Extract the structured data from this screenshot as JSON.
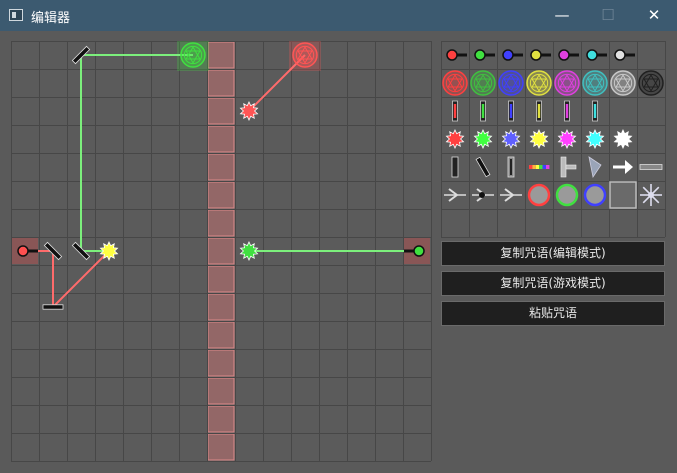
{
  "window": {
    "title": "编辑器",
    "minimize_glyph": "—",
    "maximize_glyph": "☐",
    "close_glyph": "✕"
  },
  "buttons": {
    "copy_edit": "复制咒语(编辑模式)",
    "copy_game": "复制咒语(游戏模式)",
    "paste": "粘贴咒语"
  },
  "board": {
    "cols": 15,
    "rows": 15,
    "wall_column": 7,
    "pieces": [
      {
        "type": "emitter",
        "color": "#ff5050",
        "col": 0,
        "row": 7
      },
      {
        "type": "emitter",
        "color": "#40e040",
        "col": 14,
        "row": 7,
        "dir": "left"
      },
      {
        "type": "mirror",
        "col": 2,
        "row": 0,
        "angle": -45
      },
      {
        "type": "mirror",
        "col": 1,
        "row": 7,
        "angle": 45
      },
      {
        "type": "mirror",
        "col": 2,
        "row": 7,
        "angle": 45
      },
      {
        "type": "mirror",
        "col": 1,
        "row": 9,
        "angle": 0
      },
      {
        "type": "star",
        "color": "#ffff40",
        "col": 3,
        "row": 7
      },
      {
        "type": "star",
        "color": "#ff5555",
        "col": 8,
        "row": 2
      },
      {
        "type": "star",
        "color": "#40e040",
        "col": 8,
        "row": 7
      },
      {
        "type": "target",
        "color": "#40e040",
        "col": 6,
        "row": 0
      },
      {
        "type": "target",
        "color": "#ff5555",
        "col": 10,
        "row": 0
      }
    ],
    "beams": [
      {
        "color": "#7cf07c",
        "points": [
          [
            2.5,
            0.5
          ],
          [
            6.5,
            0.5
          ]
        ]
      },
      {
        "color": "#7cf07c",
        "points": [
          [
            2.5,
            0.5
          ],
          [
            2.5,
            7.5
          ],
          [
            3.5,
            7.5
          ]
        ]
      },
      {
        "color": "#7cf07c",
        "points": [
          [
            8.5,
            7.5
          ],
          [
            14.5,
            7.5
          ]
        ]
      },
      {
        "color": "#ff6b6b",
        "points": [
          [
            0.5,
            7.5
          ],
          [
            1.5,
            7.5
          ],
          [
            1.5,
            9.5
          ],
          [
            3.5,
            7.5
          ]
        ]
      },
      {
        "color": "#ff6b6b",
        "points": [
          [
            8.5,
            2.5
          ],
          [
            10.5,
            0.5
          ]
        ]
      }
    ]
  },
  "palette": {
    "cols": 8,
    "rows": 7,
    "emitter_colors": [
      "#ff4040",
      "#40e040",
      "#4040ff",
      "#e0e040",
      "#e040e0",
      "#40e0e0",
      "#e0e0e0"
    ],
    "target_colors": [
      "#ff4040",
      "#40c040",
      "#4040ff",
      "#e0e040",
      "#e040e0",
      "#40c0c0",
      "#c8c8c8",
      "#202020"
    ],
    "stick_colors": [
      "#ff4040",
      "#40e040",
      "#4040ff",
      "#e0e040",
      "#e040e0",
      "#40e0e0"
    ],
    "star_colors": [
      "#ff4040",
      "#40ff40",
      "#6060ff",
      "#ffff40",
      "#ff40ff",
      "#40ffff",
      "#ffffff"
    ],
    "ring_colors": [
      "#ff4040",
      "#40e040",
      "#4040ff"
    ]
  }
}
